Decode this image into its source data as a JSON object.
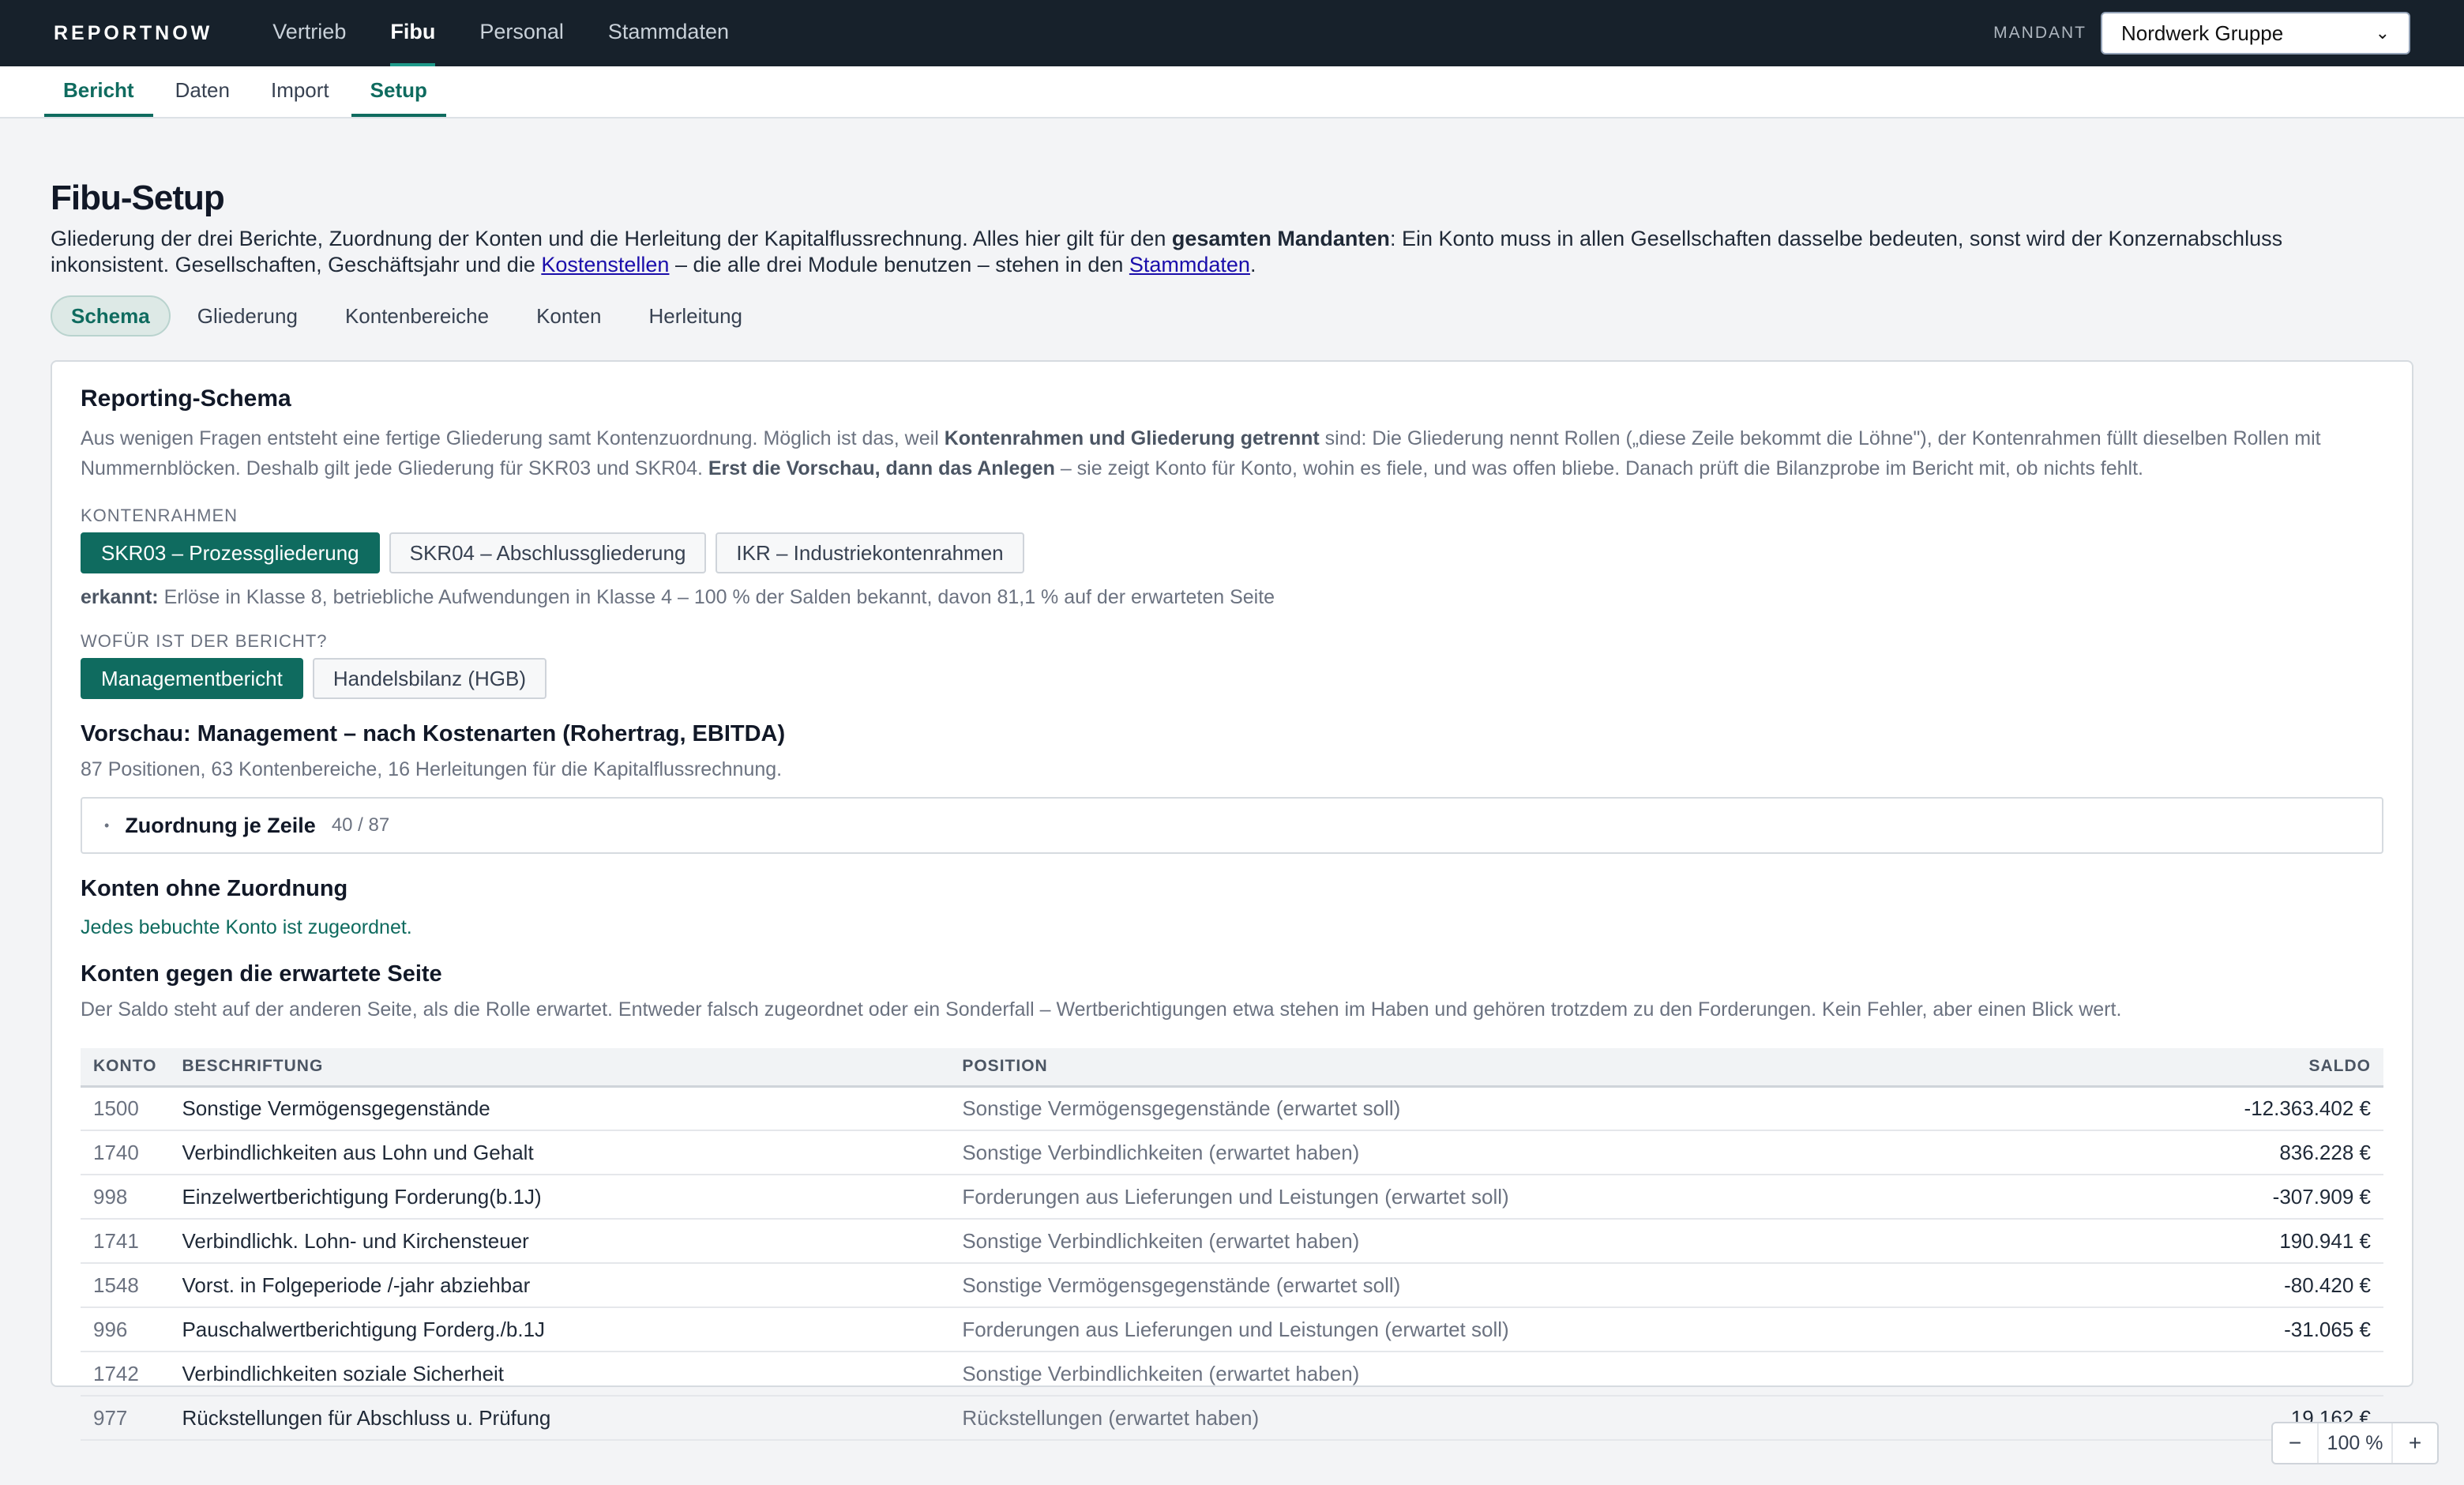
{
  "topbar": {
    "brand": "REPORTNOW",
    "nav": [
      "Vertrieb",
      "Fibu",
      "Personal",
      "Stammdaten"
    ],
    "mandant_label": "MANDANT",
    "mandant_value": "Nordwerk Gruppe"
  },
  "subnav": [
    "Bericht",
    "Daten",
    "Import",
    "Setup"
  ],
  "page": {
    "title": "Fibu-Setup",
    "intro_1": "Gliederung der drei Berichte, Zuordnung der Konten und die Herleitung der Kapitalflussrechnung. Alles hier gilt für den ",
    "intro_bold": "gesamten Mandanten",
    "intro_2": ": Ein Konto muss in allen Gesellschaften dasselbe bedeuten, sonst wird der Konzernabschluss inkonsistent. Gesellschaften, Geschäftsjahr und die ",
    "link_kostenstellen": "Kostenstellen",
    "intro_3": " – die alle drei Module benutzen – stehen in den ",
    "link_stammdaten": "Stammdaten",
    "intro_4": "."
  },
  "tabs": [
    "Schema",
    "Gliederung",
    "Kontenbereiche",
    "Konten",
    "Herleitung"
  ],
  "schema": {
    "title": "Reporting-Schema",
    "desc_1": "Aus wenigen Fragen entsteht eine fertige Gliederung samt Kontenzuordnung. Möglich ist das, weil ",
    "desc_b1": "Kontenrahmen und Gliederung getrennt",
    "desc_2": " sind: Die Gliederung nennt Rollen („diese Zeile bekommt die Löhne\"), der Kontenrahmen füllt dieselben Rollen mit Nummernblöcken. Deshalb gilt jede Gliederung für SKR03 und SKR04. ",
    "desc_b2": "Erst die Vorschau, dann das Anlegen",
    "desc_3": " – sie zeigt Konto für Konto, wohin es fiele, und was offen bliebe. Danach prüft die Bilanzprobe im Bericht mit, ob nichts fehlt.",
    "kontenrahmen_label": "KONTENRAHMEN",
    "kontenrahmen_options": [
      "SKR03 – Prozessgliederung",
      "SKR04 – Abschlussgliederung",
      "IKR – Industriekontenrahmen"
    ],
    "erkannt_label": "erkannt:",
    "erkannt_text": " Erlöse in Klasse 8, betriebliche Aufwendungen in Klasse 4 – 100 % der Salden bekannt, davon 81,1 % auf der erwarteten Seite",
    "zweck_label": "WOFÜR IST DER BERICHT?",
    "zweck_options": [
      "Managementbericht",
      "Handelsbilanz (HGB)"
    ],
    "preview_title": "Vorschau: Management – nach Kostenarten (Rohertrag, EBITDA)",
    "preview_stats": "87 Positionen, 63 Kontenbereiche, 16 Herleitungen für die Kapitalflussrechnung.",
    "collapse_title": "Zuordnung je Zeile",
    "collapse_count": "40 / 87",
    "ohne_title": "Konten ohne Zuordnung",
    "ohne_text": "Jedes bebuchte Konto ist zugeordnet.",
    "gegen_title": "Konten gegen die erwartete Seite",
    "gegen_text": "Der Saldo steht auf der anderen Seite, als die Rolle erwartet. Entweder falsch zugeordnet oder ein Sonderfall – Wertberichtigungen etwa stehen im Haben und gehören trotzdem zu den Forderungen. Kein Fehler, aber einen Blick wert."
  },
  "table": {
    "headers": [
      "KONTO",
      "BESCHRIFTUNG",
      "POSITION",
      "SALDO"
    ],
    "rows": [
      {
        "konto": "1500",
        "beschriftung": "Sonstige Vermögensgegenstände",
        "position": "Sonstige Vermögensgegenstände (erwartet soll)",
        "saldo": "-12.363.402 €"
      },
      {
        "konto": "1740",
        "beschriftung": "Verbindlichkeiten aus Lohn und Gehalt",
        "position": "Sonstige Verbindlichkeiten (erwartet haben)",
        "saldo": "836.228 €"
      },
      {
        "konto": "998",
        "beschriftung": "Einzelwertberichtigung Forderung(b.1J)",
        "position": "Forderungen aus Lieferungen und Leistungen (erwartet soll)",
        "saldo": "-307.909 €"
      },
      {
        "konto": "1741",
        "beschriftung": "Verbindlichk. Lohn- und Kirchensteuer",
        "position": "Sonstige Verbindlichkeiten (erwartet haben)",
        "saldo": "190.941 €"
      },
      {
        "konto": "1548",
        "beschriftung": "Vorst. in Folgeperiode /-jahr abziehbar",
        "position": "Sonstige Vermögensgegenstände (erwartet soll)",
        "saldo": "-80.420 €"
      },
      {
        "konto": "996",
        "beschriftung": "Pauschalwertberichtigung Forderg./b.1J",
        "position": "Forderungen aus Lieferungen und Leistungen (erwartet soll)",
        "saldo": "-31.065 €"
      },
      {
        "konto": "1742",
        "beschriftung": "Verbindlichkeiten soziale Sicherheit",
        "position": "Sonstige Verbindlichkeiten (erwartet haben)",
        "saldo": ""
      },
      {
        "konto": "977",
        "beschriftung": "Rückstellungen für Abschluss u. Prüfung",
        "position": "Rückstellungen (erwartet haben)",
        "saldo": "19.162 €"
      }
    ]
  },
  "zoom": {
    "minus": "−",
    "value": "100 %",
    "plus": "+"
  }
}
